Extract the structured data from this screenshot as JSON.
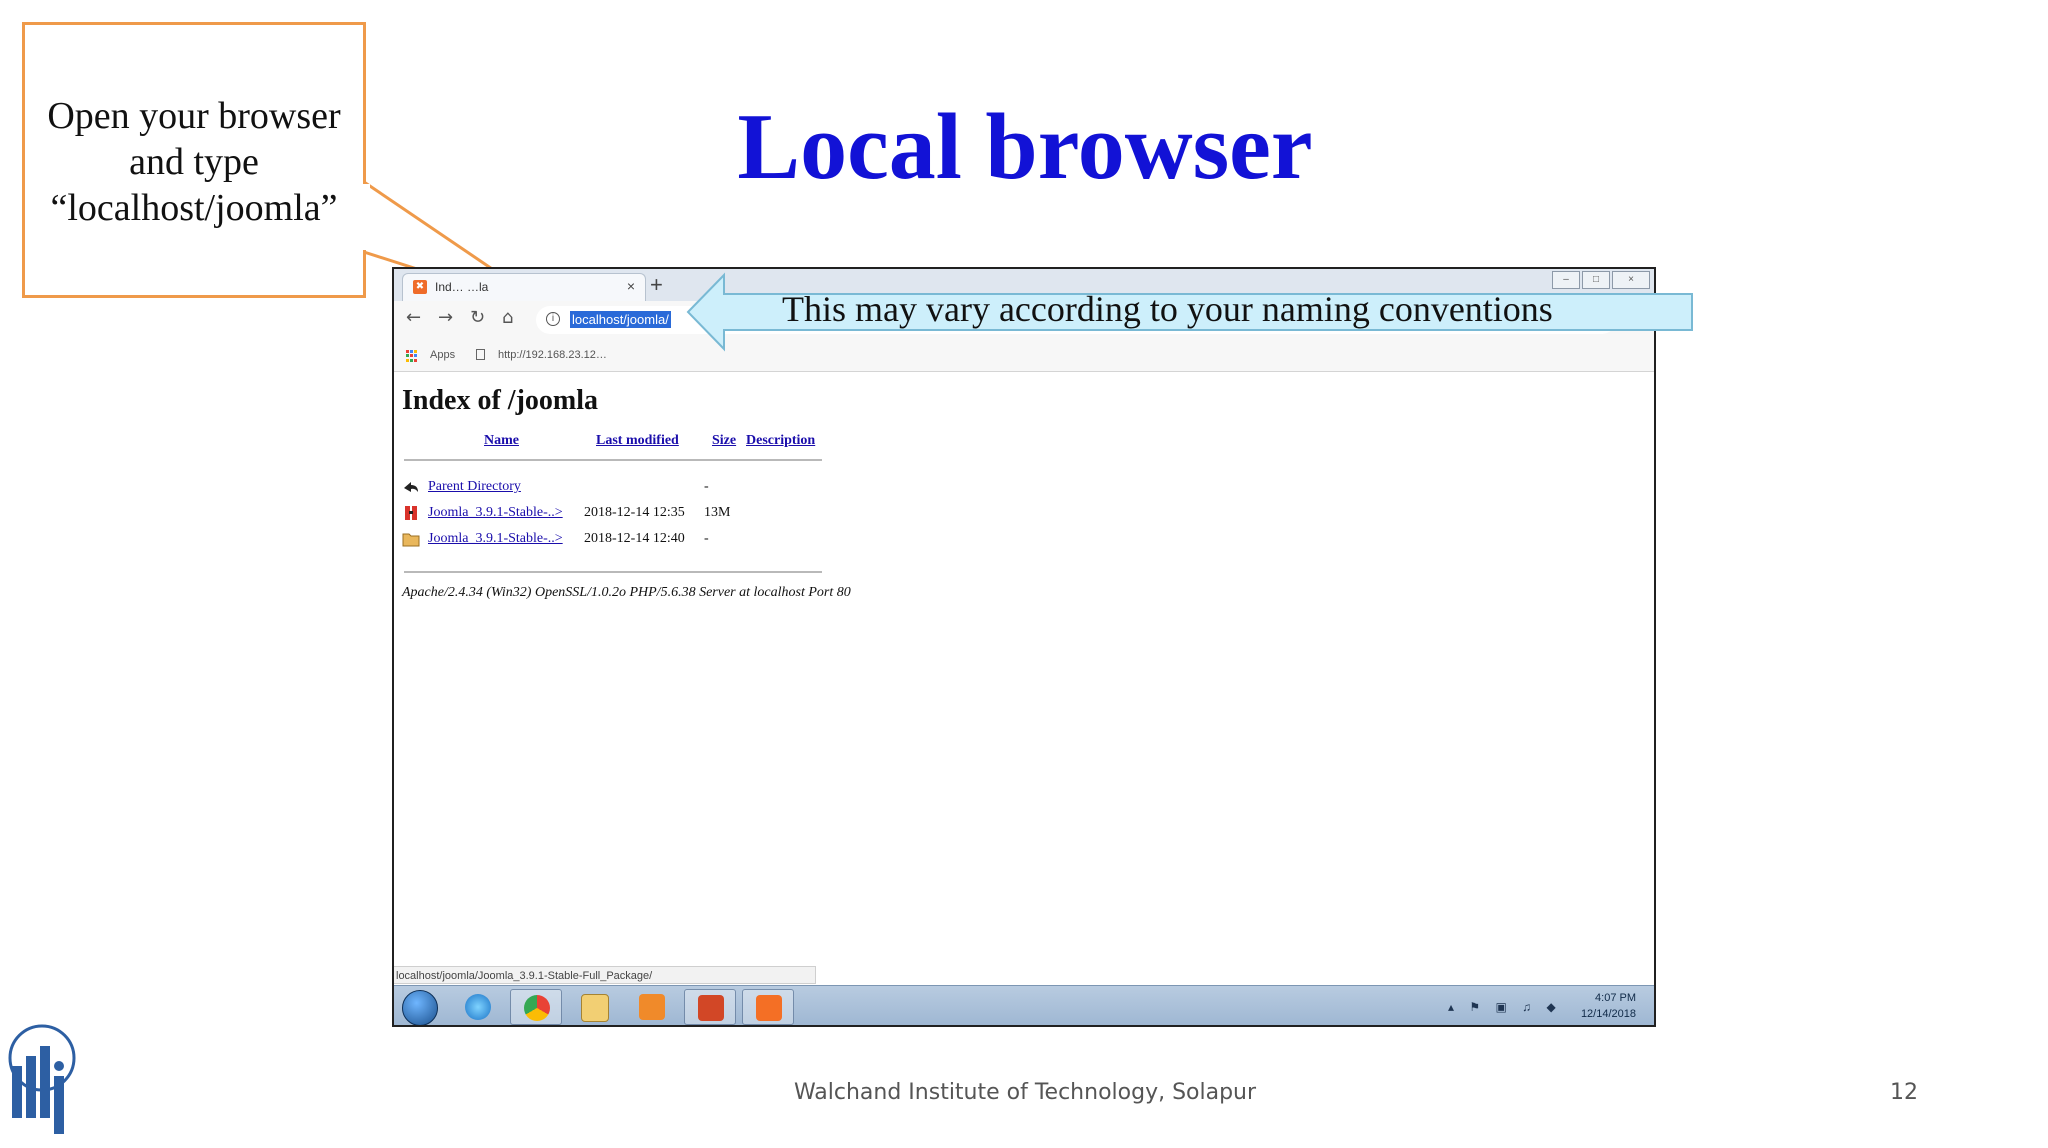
{
  "slide": {
    "title": "Local browser",
    "callout_text": "Open your  browser and type “localhost/joomla”",
    "note_text": "This may vary according to your naming conventions",
    "footer": "Walchand Institute of Technology, Solapur",
    "page_number": "12"
  },
  "browser": {
    "tab_title": "Ind… …la",
    "new_tab_symbol": "+",
    "tab_close_symbol": "×",
    "window_controls": [
      "–",
      "□",
      "×"
    ],
    "nav_buttons": [
      "←",
      "→",
      "↻",
      "⌂"
    ],
    "address_value": "localhost/joomla/",
    "bookmarks": {
      "apps_label": "Apps",
      "item_url": "http://192.168.23.12…"
    },
    "page": {
      "heading": "Index of /joomla",
      "columns": [
        "Name",
        "Last modified",
        "Size",
        "Description"
      ],
      "rows": [
        {
          "icon": "back-arrow-icon",
          "name": "Parent Directory",
          "modified": "",
          "size": "-"
        },
        {
          "icon": "compressed-file-icon",
          "name": "Joomla_3.9.1-Stable-..>",
          "modified": "2018-12-14 12:35",
          "size": "13M"
        },
        {
          "icon": "folder-icon",
          "name": "Joomla_3.9.1-Stable-..>",
          "modified": "2018-12-14 12:40",
          "size": "-"
        }
      ],
      "server_signature": "Apache/2.4.34 (Win32) OpenSSL/1.0.2o PHP/5.6.38 Server at localhost Port 80"
    },
    "status_url": "localhost/joomla/Joomla_3.9.1-Stable-Full_Package/"
  },
  "taskbar": {
    "apps": [
      "start-orb-icon",
      "internet-explorer-icon",
      "chrome-icon",
      "file-explorer-icon",
      "media-player-icon",
      "powerpoint-icon",
      "xampp-icon"
    ],
    "tray_icons": "▴ ⚑ ▣ ♫ ◆",
    "time": "4:07 PM",
    "date": "12/14/2018"
  },
  "colors": {
    "title": "#1212d6",
    "callout_border": "#ef9a4a",
    "note_fill": "#cdeffb",
    "note_border": "#79b9d4",
    "link": "#1a0dab",
    "selection": "#2a6ad8"
  }
}
